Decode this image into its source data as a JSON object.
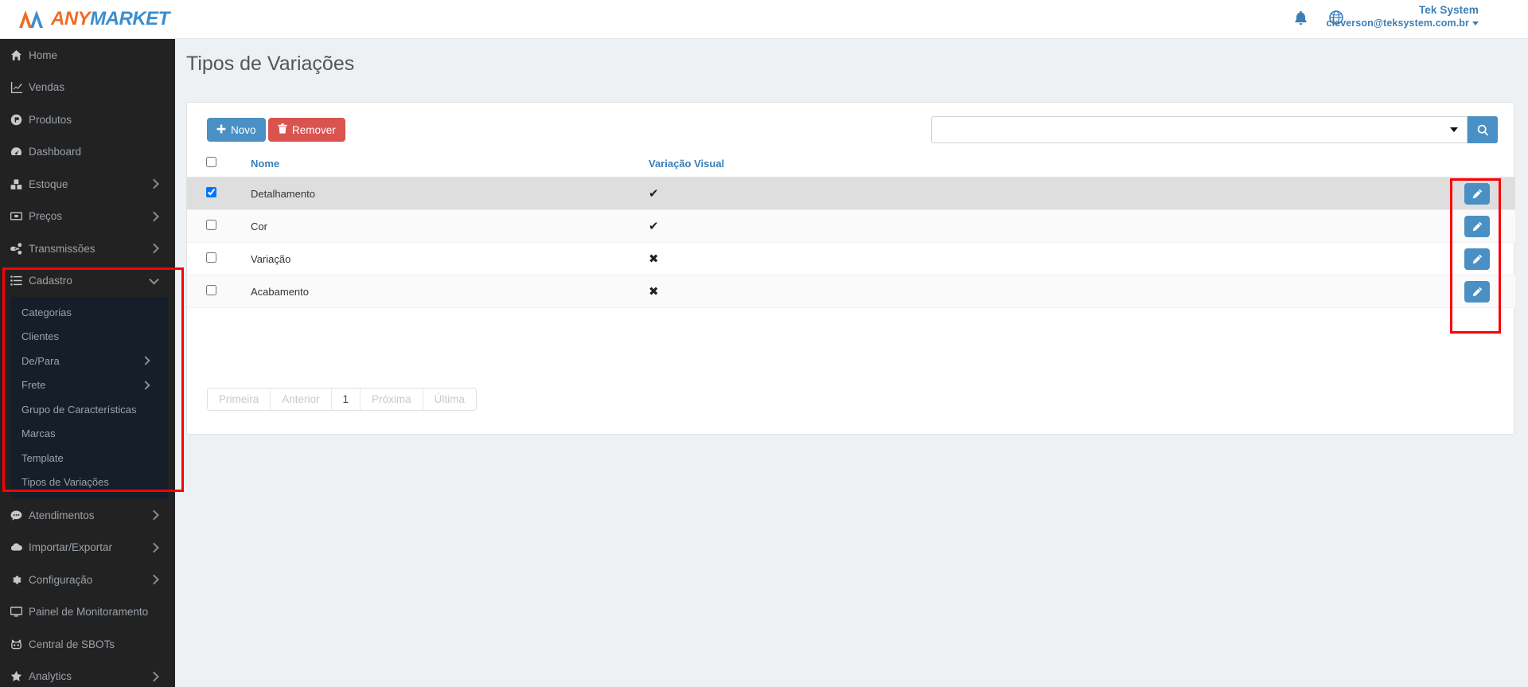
{
  "brand": {
    "logo_any": "ANY",
    "logo_market": "MARKET",
    "accent_orange": "#ef6c23",
    "accent_blue": "#3c8dcd"
  },
  "header": {
    "bell_icon": "bell-icon",
    "globe_icon": "globe-icon",
    "user_name": "Tek System",
    "user_email": "cleverson@teksystem.com.br"
  },
  "sidebar": {
    "items": [
      {
        "label": "Home",
        "icon": "home-icon",
        "chevron": "none"
      },
      {
        "label": "Vendas",
        "icon": "chart-line-icon",
        "chevron": "none"
      },
      {
        "label": "Produtos",
        "icon": "product-icon",
        "chevron": "none"
      },
      {
        "label": "Dashboard",
        "icon": "dashboard-icon",
        "chevron": "none"
      },
      {
        "label": "Estoque",
        "icon": "cubes-icon",
        "chevron": "right"
      },
      {
        "label": "Preços",
        "icon": "money-icon",
        "chevron": "right"
      },
      {
        "label": "Transmissões",
        "icon": "share-icon",
        "chevron": "right"
      },
      {
        "label": "Cadastro",
        "icon": "list-icon",
        "chevron": "down"
      }
    ],
    "submenu_cadastro": [
      {
        "label": "Categorias",
        "chevron": "none"
      },
      {
        "label": "Clientes",
        "chevron": "none"
      },
      {
        "label": "De/Para",
        "chevron": "right"
      },
      {
        "label": "Frete",
        "chevron": "right"
      },
      {
        "label": "Grupo de Características",
        "chevron": "none"
      },
      {
        "label": "Marcas",
        "chevron": "none"
      },
      {
        "label": "Template",
        "chevron": "none"
      },
      {
        "label": "Tipos de Variações",
        "chevron": "none"
      }
    ],
    "items_bottom": [
      {
        "label": "Atendimentos",
        "icon": "comment-icon",
        "chevron": "right"
      },
      {
        "label": "Importar/Exportar",
        "icon": "cloud-icon",
        "chevron": "right"
      },
      {
        "label": "Configuração",
        "icon": "gear-icon",
        "chevron": "right"
      },
      {
        "label": "Painel de Monitoramento",
        "icon": "desktop-icon",
        "chevron": "none"
      },
      {
        "label": "Central de SBOTs",
        "icon": "robot-icon",
        "chevron": "none"
      },
      {
        "label": "Analytics",
        "icon": "star-icon",
        "chevron": "right"
      }
    ]
  },
  "page": {
    "title": "Tipos de Variações"
  },
  "toolbar": {
    "novo_label": "Novo",
    "novo_icon": "plus-icon",
    "novo_color": "#4a90c4",
    "remover_label": "Remover",
    "remover_icon": "trash-icon",
    "remover_color": "#d9534f",
    "search_value": "",
    "search_placeholder": "",
    "search_icon": "search-icon",
    "dropdown_icon": "chevron-down-icon"
  },
  "table": {
    "columns": [
      "",
      "Nome",
      "Variação Visual",
      ""
    ],
    "header_checkbox_checked": false,
    "rows": [
      {
        "checked": true,
        "nome": "Detalhamento",
        "variacao_visual": "yes",
        "visual_glyph": "✔",
        "selected": true,
        "edit_icon": "pencil-icon",
        "edit_label": ""
      },
      {
        "checked": false,
        "nome": "Cor",
        "variacao_visual": "yes",
        "visual_glyph": "✔",
        "selected": false,
        "edit_icon": "pencil-icon",
        "edit_label": ""
      },
      {
        "checked": false,
        "nome": "Variação",
        "variacao_visual": "no",
        "visual_glyph": "✖",
        "selected": false,
        "edit_icon": "pencil-icon",
        "edit_label": ""
      },
      {
        "checked": false,
        "nome": "Acabamento",
        "variacao_visual": "no",
        "visual_glyph": "✖",
        "selected": false,
        "edit_icon": "pencil-icon",
        "edit_label": ""
      }
    ]
  },
  "pagination": {
    "first": "Primeira",
    "previous": "Anterior",
    "current_page": "1",
    "next": "Próxima",
    "last": "Última"
  },
  "annotations": {
    "color": "#fb0007",
    "boxes": [
      {
        "name": "cadastro-menu-highlight"
      },
      {
        "name": "edit-buttons-highlight"
      }
    ]
  }
}
